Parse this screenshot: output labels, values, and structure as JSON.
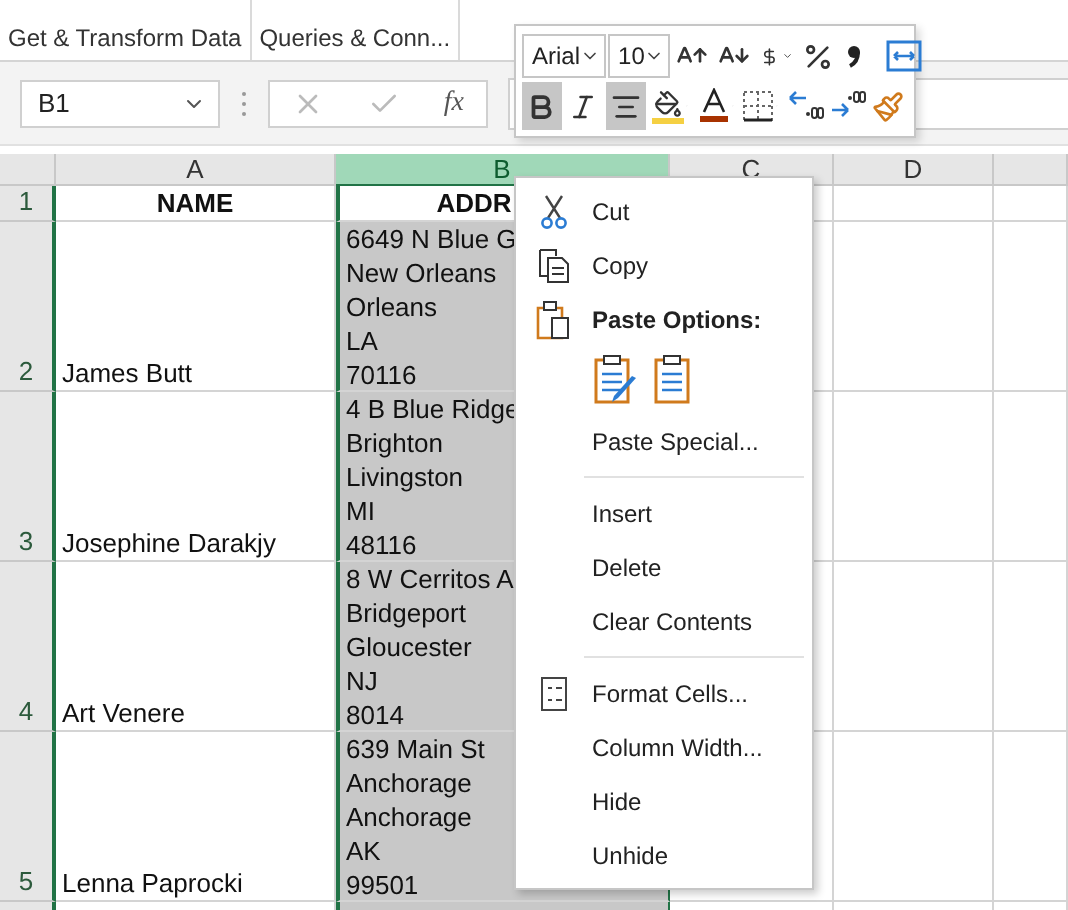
{
  "ribbon": {
    "groups": [
      "Get & Transform Data",
      "Queries & Conn..."
    ]
  },
  "formula_bar": {
    "name_box": "B1",
    "function_label": "fx"
  },
  "mini_toolbar": {
    "font": "Arial",
    "size": "10",
    "row1": [
      {
        "kind": "grow",
        "selected": false
      },
      {
        "kind": "shrink",
        "selected": false
      },
      {
        "kind": "currency",
        "selected": false,
        "dropdown": true
      },
      {
        "kind": "percent",
        "selected": false
      },
      {
        "kind": "comma",
        "selected": false
      },
      {
        "kind": "wrap",
        "selected": false
      }
    ],
    "row2": [
      {
        "kind": "bold",
        "selected": true
      },
      {
        "kind": "italic",
        "selected": false
      },
      {
        "kind": "center",
        "selected": true
      },
      {
        "kind": "fill",
        "selected": false,
        "dropdown": true
      },
      {
        "kind": "font_color",
        "selected": false,
        "dropdown": true
      },
      {
        "kind": "borders",
        "selected": false,
        "dropdown": true
      },
      {
        "kind": "increase_decimal",
        "selected": false
      },
      {
        "kind": "decrease_decimal",
        "selected": false
      },
      {
        "kind": "painter",
        "selected": false
      }
    ]
  },
  "sheet": {
    "columns": [
      {
        "label": "A",
        "selected": false
      },
      {
        "label": "B",
        "selected": true
      },
      {
        "label": "C",
        "selected": false
      },
      {
        "label": "D",
        "selected": false
      }
    ],
    "rows": [
      {
        "kind": "header",
        "number": "1",
        "name": "NAME",
        "address": "ADDR"
      },
      {
        "kind": "data",
        "number": "2",
        "name": "James Butt",
        "address": "6649 N Blue G\nNew Orleans\nOrleans\nLA\n70116"
      },
      {
        "kind": "data",
        "number": "3",
        "name": "Josephine Darakjy",
        "address": "4 B Blue Ridge\nBrighton\nLivingston\nMI\n48116"
      },
      {
        "kind": "data",
        "number": "4",
        "name": "Art Venere",
        "address": "8 W Cerritos A\nBridgeport\nGloucester\nNJ\n8014"
      },
      {
        "kind": "data",
        "number": "5",
        "name": "Lenna Paprocki",
        "address": "639 Main St\nAnchorage\nAnchorage\nAK\n99501"
      }
    ]
  },
  "context_menu": [
    {
      "kind": "item",
      "label": "Cut",
      "icon": true
    },
    {
      "kind": "item",
      "label": "Copy",
      "icon": true
    },
    {
      "kind": "heading",
      "label": "Paste Options:",
      "icon": true
    },
    {
      "kind": "paste_icons"
    },
    {
      "kind": "item",
      "label": "Paste Special...",
      "icon": false
    },
    {
      "kind": "separator"
    },
    {
      "kind": "item",
      "label": "Insert",
      "icon": false
    },
    {
      "kind": "item",
      "label": "Delete",
      "icon": false
    },
    {
      "kind": "item",
      "label": "Clear Contents",
      "icon": false
    },
    {
      "kind": "separator"
    },
    {
      "kind": "item",
      "label": "Format Cells...",
      "icon": true
    },
    {
      "kind": "item",
      "label": "Column Width...",
      "icon": false
    },
    {
      "kind": "item",
      "label": "Hide",
      "icon": false
    },
    {
      "kind": "item",
      "label": "Unhide",
      "icon": false
    }
  ]
}
